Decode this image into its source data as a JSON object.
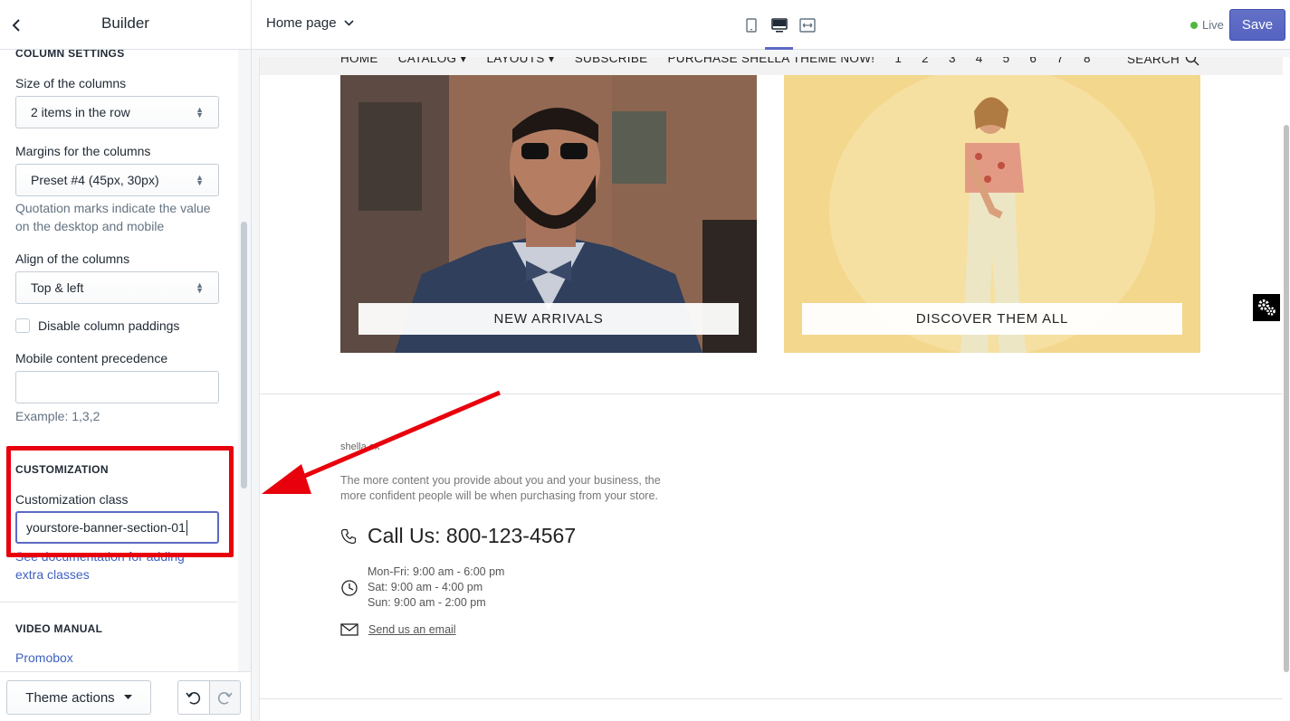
{
  "sidebar": {
    "title": "Builder",
    "column_settings": {
      "heading": "COLUMN SETTINGS",
      "size_label": "Size of the columns",
      "size_value": "2 items in the row",
      "margins_label": "Margins for the columns",
      "margins_value": "Preset #4 (45px, 30px)",
      "margins_help": "Quotation marks indicate the value on the desktop and mobile",
      "align_label": "Align of the columns",
      "align_value": "Top & left",
      "disable_paddings_label": "Disable column paddings",
      "mobile_precedence_label": "Mobile content precedence",
      "mobile_precedence_value": "",
      "mobile_precedence_help": "Example: 1,3,2"
    },
    "customization": {
      "heading": "CUSTOMIZATION",
      "class_label": "Customization class",
      "class_value": "yourstore-banner-section-01",
      "doc_link": "See documentation for adding extra classes"
    },
    "video_manual": {
      "heading": "VIDEO MANUAL",
      "link": "Promobox"
    },
    "footer": {
      "theme_actions": "Theme actions"
    }
  },
  "topbar": {
    "page": "Home page",
    "live": "Live",
    "save": "Save",
    "accent": "#5c6ac4"
  },
  "preview": {
    "nav": [
      "HOME",
      "CATALOG",
      "LAYOUTS",
      "SUBSCRIBE",
      "PURCHASE SHELLA THEME NOW!",
      "1",
      "2",
      "3",
      "4",
      "5",
      "6",
      "7",
      "8"
    ],
    "search": "SEARCH",
    "banners": [
      {
        "label": "NEW ARRIVALS"
      },
      {
        "label": "DISCOVER THEM ALL"
      }
    ],
    "footer": {
      "logo": "shella.ex",
      "about": "The more content you provide about you and your business, the more confident people will be when purchasing from your store.",
      "call": "Call Us: 800-123-4567",
      "hours": [
        "Mon-Fri: 9:00 am - 6:00 pm",
        "Sat: 9:00 am - 4:00 pm",
        "Sun: 9:00 am - 2:00 pm"
      ],
      "email": "Send us an email"
    }
  },
  "annotation": {
    "highlight_color": "#e8000c"
  }
}
